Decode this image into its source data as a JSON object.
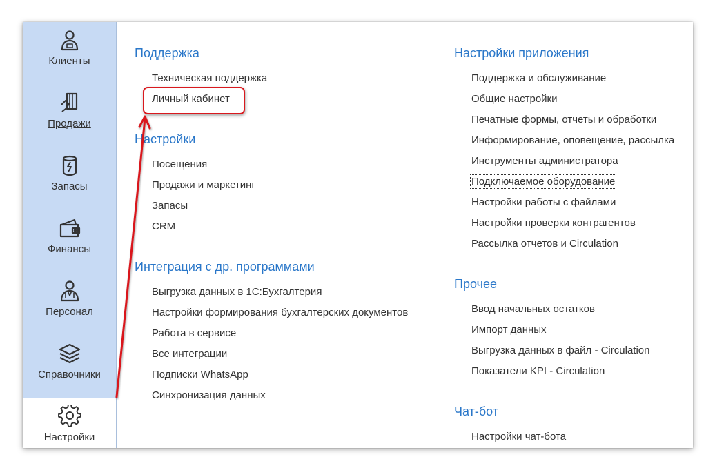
{
  "sidebar": {
    "items": [
      {
        "label": "Клиенты",
        "icon": "client-icon",
        "active": false,
        "underlined": false
      },
      {
        "label": "Продажи",
        "icon": "sales-icon",
        "active": false,
        "underlined": true
      },
      {
        "label": "Запасы",
        "icon": "stock-icon",
        "active": false,
        "underlined": false
      },
      {
        "label": "Финансы",
        "icon": "wallet-icon",
        "active": false,
        "underlined": false
      },
      {
        "label": "Персонал",
        "icon": "staff-icon",
        "active": false,
        "underlined": false
      },
      {
        "label": "Справочники",
        "icon": "layers-icon",
        "active": false,
        "underlined": false
      },
      {
        "label": "Настройки",
        "icon": "gear-icon",
        "active": true,
        "underlined": false
      }
    ]
  },
  "groups": {
    "support": {
      "title": "Поддержка",
      "items": [
        "Техническая поддержка",
        "Личный кабинет"
      ]
    },
    "settings": {
      "title": "Настройки",
      "items": [
        "Посещения",
        "Продажи и маркетинг",
        "Запасы",
        "CRM"
      ]
    },
    "integration": {
      "title": "Интеграция с др. программами",
      "items": [
        "Выгрузка данных в 1С:Бухгалтерия",
        "Настройки формирования бухгалтерских документов",
        "Работа в сервисе",
        "Все интеграции",
        "Подписки WhatsApp",
        "Синхронизация данных"
      ]
    },
    "app_settings": {
      "title": "Настройки приложения",
      "items": [
        "Поддержка и обслуживание",
        "Общие настройки",
        "Печатные формы, отчеты и обработки",
        "Информирование, оповещение, рассылка",
        "Инструменты администратора",
        "Подключаемое оборудование",
        "Настройки работы с файлами",
        "Настройки проверки контрагентов",
        "Рассылка отчетов и Circulation"
      ]
    },
    "other": {
      "title": "Прочее",
      "items": [
        "Ввод начальных остатков",
        "Импорт данных",
        "Выгрузка данных в файл - Circulation",
        "Показатели KPI - Circulation"
      ]
    },
    "chatbot": {
      "title": "Чат-бот",
      "items": [
        "Настройки чат-бота"
      ]
    }
  },
  "colors": {
    "sidebar_bg": "#c7daf4",
    "group_title": "#2a77c9",
    "link_text": "#333333",
    "annotation_red": "#d9191e"
  },
  "annotation": {
    "highlighted_item": "Личный кабинет",
    "focused_item": "Подключаемое оборудование"
  }
}
